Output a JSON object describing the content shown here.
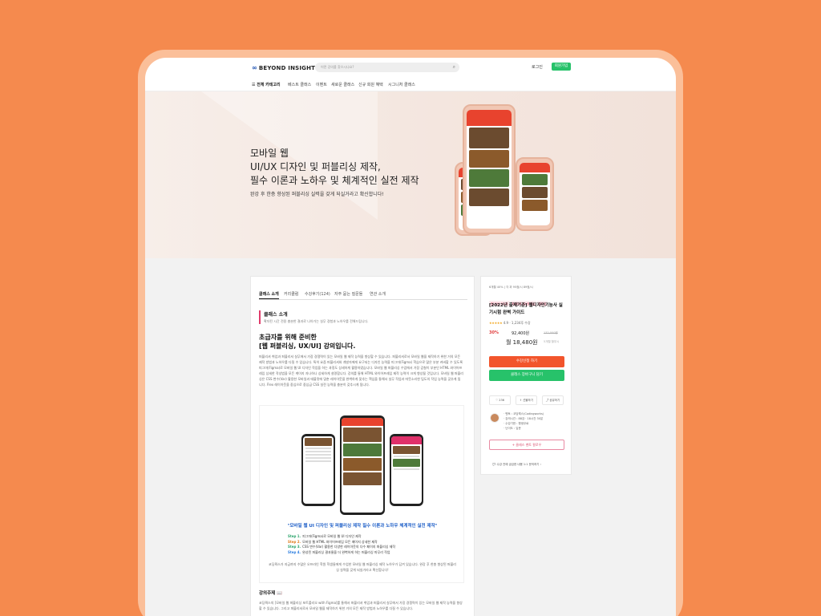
{
  "header": {
    "logo": "BEYOND INSIGHT",
    "search_placeholder": "어떤 강의를 찾으시나요?",
    "login": "로그인",
    "signup": "회원가입"
  },
  "nav": {
    "all_categories": "전체 카테고리",
    "items": [
      "베스트 클래스",
      "이벤트",
      "새로운 클래스",
      "신규 회원 혜택",
      "시그니처 클래스"
    ]
  },
  "hero": {
    "title_lines": [
      "모바일 웹",
      "UI/UX 디자인 및 퍼블리싱 제작,",
      "필수 이론과 노하우 및 체계적인 실전 제작"
    ],
    "subtitle": "완강 후 한층 향상된 퍼블리싱 실력을 갖게 되실거라고 확신합니다!"
  },
  "tabs": [
    "클래스 소개",
    "커리큘럼",
    "수강후기(124)",
    "자주 묻는 질문들",
    "연관 소개"
  ],
  "intro": {
    "heading": "클래스 소개",
    "desc": "확자된 시간 전용 충분한 결과로 나아가는 실무 경험과 노하우를 전해드립니다."
  },
  "big_heading": [
    "초급자를 위해 준비한",
    "[웹 퍼블리싱, UX/UI] 강의입니다."
  ],
  "paragraph": "퍼블리셔 취업과 퍼블리셔 실무에서 가장 경쟁력이 있는 모바일 웹 제작 능력을 향상할 수 있습니다. 퍼블리셔로서 모바일 웹을 제작하기 위한 거의 모든 제작 방법과 노하우를 다질 수 있습니다. 특히 요즘 퍼블리셔와 개발자에게 요구되는 디자인 능력을 피그마(Figma) 학습으로 많은 부분 커버할 수 있도록 피그마(Figma)로 모바일 웹 UI 디자인 작업을 하는 과정도 상세하게 활용하였습니다. 모바일 웹 퍼블리싱 수업에서 가장 감칠이 부분인 HTML 와이어프레임 상세한 작성법을 모든 케이지 자나하나 상세하게 설명합니다. 강의를 통해 HTML 와이어프레임 제작 능력이 크게 향상될 것입니다. 모바일 웹 퍼블리싱은 CSS 변수(Var) 활용한 모바일과 태블릿에 맞춘 레이아웃을 완벽하게 맞추는 핵심을 통해서 실무 작업과 따뜻소리한 팁도의 작업 능력을 갖추게 됩니다. Flex 레이아웃을 중심으로 중심급 CSS 실전 능력을 충분히 갖추시게 됩니다.",
  "promo": {
    "quote": "\"모바일 웹 UI 디자인 및 퍼블리싱 제작 필수 이론과 노하우 체계적인 실전 제작\"",
    "steps": [
      {
        "label": "Step 1.",
        "text": "피그마(Figma)로 모바일 웹 UI 디자인 제작"
      },
      {
        "label": "Step 2.",
        "text": "모바일 웹 HTML 와이어프레임 모든 페이지 상세한 제작"
      },
      {
        "label": "Step 3.",
        "text": "CSS 변수(Var) 활용한 다양한 레이아웃의 다수 페이지 퍼블리싱 제작"
      },
      {
        "label": "Step 4.",
        "text": "완성된 퍼블리싱 결과물을 더 완벽하게 하는 퍼블리싱 마무리 작업"
      }
    ],
    "closing": "코딩웍스가 지금까지 수많은 오프라인 학원 학생들에게 수업한 모바일 웹 퍼블리싱 제작 노하우가 담겨 있습니다. 완강 후 한층 향상된 퍼블리싱 실력을 갖게 되실거라고 확신합니다!"
  },
  "topic": {
    "heading": "강의주제 📖",
    "text": "코딩웍스의 [모바일 웹 퍼블리싱 포트폴리오 with Figma]를 통해서 퍼블리셔 취업과 퍼블리셔 실무에서 가장 경쟁력이 있는 모바일 웹 제작 능력을 향상할 수 있습니다. 그리고 퍼블리셔로서 모바일 웹을 제작하기 위한 거의 모든 제작 방법과 노하우를 다질 수 있습니다."
  },
  "side": {
    "meta": "6개월 40% | 각 과 95점/시 89점/시",
    "tags": [
      "웹디자인 포트폴",
      "퍼블리셔 포트폴 학습",
      "웹퍼블"
    ],
    "title": "[2022년 출제기준] 웹디자인기능사 실기시험 완벽 가이드",
    "stars": "★★★★★",
    "rating": "4.9 · 1,234후 수강",
    "discount": "30%",
    "price": "92,400원",
    "original_price": "132,000원",
    "monthly": "월 18,480원",
    "months": "5개월 할부시",
    "apply_button": "수강신청 하기",
    "cart_button": "클래스 장바구니 담기",
    "actions": [
      "♡ 236",
      "⇪ 선물하기",
      "⤴ 공유하기"
    ],
    "instructor_info": [
      "· 멘토 : 코딩웍스(Codingworks)",
      "· 강의시간 : 88강 · 18시간 30분",
      "· 수강기한 : 평생무료",
      "· 난이도 : 입문"
    ],
    "follow_button": "+ 클래스 멘토 팔로우",
    "inquiry": "💬 수강 전에 궁금한 내용 1:1 문의하기 ›"
  },
  "colors": {
    "background": "#f58a4e",
    "primary_green": "#27c26a",
    "primary_orange": "#f2552c",
    "accent_blue": "#2060c8",
    "accent_pink": "#e03c6b"
  }
}
